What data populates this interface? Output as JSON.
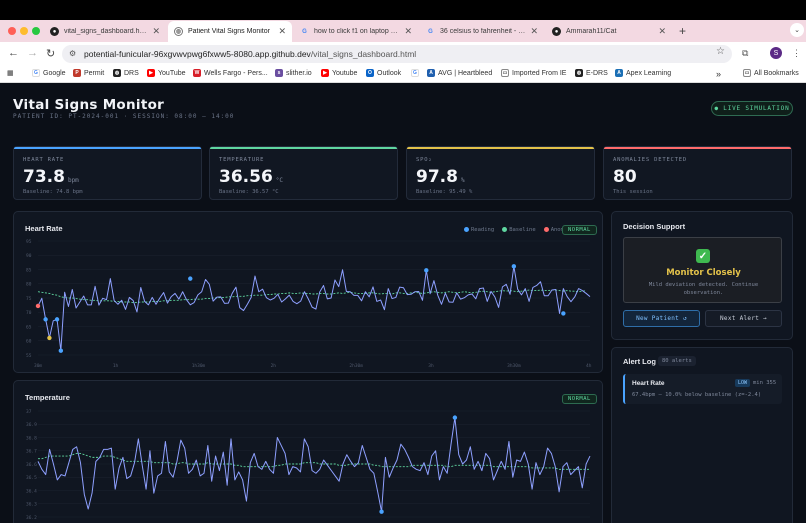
{
  "browser": {
    "tabs": [
      {
        "title": "vital_signs_dashboard.html",
        "favicon": "github-icon",
        "active": false
      },
      {
        "title": "Patient Vital Signs Monitor",
        "favicon": "globe-icon",
        "active": true
      },
      {
        "title": "how to click f1 on laptop - Go",
        "favicon": "google-icon",
        "active": false
      },
      {
        "title": "36 celsius to fahrenheit - Goo",
        "favicon": "google-icon",
        "active": false
      },
      {
        "title": "Ammarah11/Cat",
        "favicon": "github-icon",
        "active": false
      }
    ],
    "url_host": "potential-funicular-96xgvwvpwg6fxww5-8080.app.github.dev",
    "url_path": "/vital_signs_dashboard.html",
    "bookmarks": [
      {
        "label": "Google",
        "icon": "google-icon",
        "color": "#4285f4"
      },
      {
        "label": "Permit",
        "icon": "permit-icon",
        "color": "#c0392b"
      },
      {
        "label": "DRS",
        "icon": "globe-icon",
        "color": "#222222"
      },
      {
        "label": "YouTube",
        "icon": "youtube-icon",
        "color": "#ff0000"
      },
      {
        "label": "Wells Fargo - Pers...",
        "icon": "wellsfargo-icon",
        "color": "#d71e28"
      },
      {
        "label": "slither.io",
        "icon": "slither-icon",
        "color": "#6a4ea0"
      },
      {
        "label": "Youtube",
        "icon": "youtube-icon",
        "color": "#ff0000"
      },
      {
        "label": "Outlook",
        "icon": "outlook-icon",
        "color": "#0a64c8"
      },
      {
        "label": "",
        "icon": "google-icon",
        "color": "#4285f4"
      },
      {
        "label": "AVG | Heartbleed",
        "icon": "avg-icon",
        "color": "#1f5fae"
      },
      {
        "label": "Imported From IE",
        "icon": "folder-icon",
        "color": "#555555"
      },
      {
        "label": "E-DRS",
        "icon": "globe-icon",
        "color": "#222222"
      },
      {
        "label": "Apex Learning",
        "icon": "apex-icon",
        "color": "#1b6fb5"
      }
    ],
    "all_bookmarks": "All Bookmarks"
  },
  "header": {
    "title": "Vital Signs Monitor",
    "subtitle": "PATIENT ID: PT-2024-001  ·  SESSION: 08:00 – 14:00",
    "live_button": "● LIVE SIMULATION"
  },
  "kpis": [
    {
      "label": "Heart Rate",
      "value": "73.8",
      "unit": "bpm",
      "baseline": "Baseline: 74.8 bpm",
      "accent": "#4aa3ff"
    },
    {
      "label": "Temperature",
      "value": "36.56",
      "unit": "°C",
      "baseline": "Baseline: 36.57 °C",
      "accent": "#5fd6a0"
    },
    {
      "label": "SpO₂",
      "value": "97.8",
      "unit": "%",
      "baseline": "Baseline: 95.49 %",
      "accent": "#e3c24a"
    },
    {
      "label": "Anomalies Detected",
      "value": "80",
      "unit": "",
      "baseline": "This session",
      "accent": "#ff6b6b"
    }
  ],
  "heart_chart": {
    "title": "Heart Rate",
    "status": "NORMAL",
    "legend": [
      "Reading",
      "Baseline",
      "Anomaly"
    ],
    "colors": {
      "reading": "#8ea0ff",
      "baseline": "#5fd6a0",
      "anomaly": "#ff6b6b",
      "marker": "#4aa3ff"
    }
  },
  "temp_chart": {
    "title": "Temperature",
    "status": "NORMAL"
  },
  "decision": {
    "title": "Decision Support",
    "status": "Monitor Closely",
    "description": "Mild deviation detected. Continue observation.",
    "new_patient": "New Patient ↺",
    "next_alert": "Next Alert →"
  },
  "alerts": {
    "title": "Alert Log",
    "count": "80 alerts",
    "items": [
      {
        "name": "Heart Rate",
        "severity": "LOW",
        "time": "min 355",
        "desc": "67.4bpm — 10.0% below baseline (z=-2.4)"
      }
    ]
  },
  "chart_data": [
    {
      "type": "line",
      "title": "Heart Rate",
      "ylim": [
        55,
        95
      ],
      "y_ticks": [
        55,
        60,
        65,
        70,
        75,
        80,
        85,
        90,
        95
      ],
      "x_ticks": [
        "30m",
        "1h",
        "1h30m",
        "2h",
        "2h30m",
        "3h",
        "3h30m",
        "4h"
      ],
      "series": [
        {
          "name": "Reading",
          "values": [
            72.2,
            74.9,
            67.5,
            61.0,
            67.0,
            67.5,
            56.5,
            77.0,
            72.0,
            78.0,
            71.5,
            73.6,
            75.7,
            72.6,
            72.6,
            79.1,
            72.5,
            74.9,
            74.4,
            81.8,
            74.1,
            72.8,
            74.2,
            71.0,
            75.2,
            74.1,
            70.1,
            78.7,
            73.8,
            72.6,
            75.2,
            72.8,
            75.0,
            76.9,
            73.2,
            75.5,
            76.6,
            74.6,
            77.2,
            74.4,
            72.6,
            73.4,
            76.1,
            77.2,
            81.5,
            79.8,
            73.9,
            75.3,
            75.4,
            73.1,
            73.2,
            76.6,
            78.8,
            71.6,
            70.6,
            72.8,
            75.2,
            82.7,
            77.2,
            78.1,
            75.1,
            74.3,
            74.9,
            76.3,
            73.6,
            74.7,
            76.0,
            73.8,
            73.0,
            73.9,
            77.2,
            74.7,
            71.8,
            71.1,
            77.1,
            79.4,
            74.7,
            75.0,
            81.3,
            79.0,
            84.9,
            77.3,
            77.2,
            75.9,
            75.9,
            74.0,
            77.2,
            75.4,
            78.9,
            73.8,
            74.3,
            70.9,
            78.3,
            74.8,
            75.2,
            78.8,
            78.6,
            76.2,
            76.3,
            77.2,
            77.3,
            74.2,
            84.7,
            76.5,
            81.1,
            76.0,
            72.8,
            76.7,
            73.6,
            73.5,
            76.8,
            74.6,
            75.1,
            76.1,
            76.4,
            74.7,
            78.3,
            78.5,
            73.8,
            77.3,
            75.4,
            71.7,
            78.9,
            79.8,
            76.3,
            86.1,
            78.1,
            76.1,
            78.3,
            73.8,
            78.7,
            79.4,
            80.7,
            75.8,
            75.8,
            77.8,
            78.0,
            69.6,
            78.3,
            75.5,
            73.7,
            75.4,
            78.3,
            77.6,
            76.6,
            75.5
          ]
        },
        {
          "name": "Baseline",
          "values": [
            77.2,
            77.0,
            76.8,
            76.6,
            76.2,
            76.0,
            75.4,
            75.2,
            75.0,
            75.0,
            74.8,
            74.6,
            74.4,
            74.4,
            74.2,
            74.2,
            74.0,
            74.0,
            74.0,
            74.0,
            73.8,
            73.8,
            73.6,
            73.6,
            73.6,
            73.4,
            73.4,
            73.6,
            73.6,
            73.6,
            73.8,
            73.8,
            73.8,
            74.0,
            74.0,
            74.2,
            74.2,
            74.2,
            74.4,
            74.4,
            74.4,
            74.6,
            74.6,
            74.6,
            74.8,
            74.8,
            75.0,
            75.0,
            75.2,
            75.2,
            75.4,
            75.4,
            75.6,
            75.6,
            75.6,
            75.8,
            75.8,
            76.0,
            76.0,
            76.0,
            76.2,
            76.2,
            76.4,
            76.4,
            76.6,
            76.6,
            76.8,
            76.6,
            76.6,
            76.8,
            76.6,
            76.6,
            76.4,
            76.4,
            76.6,
            76.6,
            76.4,
            76.4,
            76.6,
            76.8,
            76.6,
            76.8,
            77.0,
            76.8,
            76.6,
            76.6,
            76.6,
            76.8,
            76.8,
            76.6,
            76.4,
            76.6,
            76.6,
            76.4,
            76.8,
            76.8,
            76.6,
            76.6,
            76.8,
            77.0,
            76.8,
            76.6,
            76.8,
            77.0,
            77.2,
            77.0,
            76.8,
            77.0,
            77.2,
            77.0,
            76.8,
            77.0,
            77.2,
            77.0,
            76.8,
            77.0,
            77.2,
            77.4,
            77.2,
            77.0,
            77.2,
            77.4,
            77.6,
            77.4,
            77.6,
            77.4,
            77.2,
            77.4,
            77.6,
            77.8,
            77.6,
            77.6,
            77.8,
            77.6,
            77.6,
            77.8,
            77.8,
            77.6,
            77.4,
            77.6,
            77.4,
            77.4,
            77.2,
            77.4,
            77.6
          ]
        }
      ],
      "anomalies": [
        [
          0,
          72.2
        ],
        [
          2,
          67.5
        ],
        [
          3,
          61.0
        ],
        [
          5,
          67.5
        ],
        [
          6,
          56.5
        ],
        [
          40,
          81.8
        ],
        [
          102,
          84.7
        ],
        [
          125,
          86.1
        ],
        [
          138,
          69.6
        ]
      ]
    },
    {
      "type": "line",
      "title": "Temperature",
      "ylim": [
        36.2,
        37.0
      ],
      "y_ticks": [
        36.2,
        36.3,
        36.4,
        36.5,
        36.6,
        36.7,
        36.8,
        36.9,
        37.0
      ],
      "series": [
        {
          "name": "Reading",
          "values": [
            36.62,
            36.56,
            36.52,
            36.71,
            36.6,
            36.48,
            36.52,
            36.51,
            36.61,
            36.71,
            36.73,
            36.61,
            36.37,
            36.26,
            36.38,
            36.62,
            36.65,
            36.71,
            36.71,
            36.72,
            36.41,
            36.57,
            36.65,
            36.49,
            36.51,
            36.61,
            36.79,
            36.59,
            36.41,
            36.7,
            36.38,
            36.51,
            36.53,
            36.77,
            36.54,
            36.5,
            36.62,
            36.78,
            36.72,
            36.53,
            36.56,
            36.63,
            36.51,
            36.53,
            36.74,
            36.47,
            36.66,
            36.55,
            36.69,
            36.44,
            36.79,
            36.48,
            36.54,
            36.48,
            36.32,
            36.61,
            36.68,
            36.58,
            36.56,
            36.62,
            36.56,
            36.53,
            36.8,
            36.74,
            36.68,
            36.52,
            36.58,
            36.57,
            36.54,
            36.79,
            36.73,
            36.55,
            36.53,
            36.56,
            36.63,
            36.59,
            36.55,
            36.51,
            36.47,
            36.6,
            36.67,
            36.62,
            36.58,
            36.61,
            36.74,
            36.65,
            36.56,
            36.53,
            36.39,
            36.24,
            36.65,
            36.5,
            36.57,
            36.63,
            36.75,
            36.71,
            36.65,
            36.58,
            36.56,
            36.55,
            36.61,
            36.52,
            36.66,
            36.7,
            36.48,
            36.58,
            36.53,
            36.75,
            36.95,
            36.67,
            36.6,
            36.63,
            36.73,
            36.56,
            36.62,
            36.55,
            36.68,
            36.64,
            36.48,
            36.55,
            36.62,
            36.56,
            36.77,
            36.5,
            36.63,
            36.62,
            36.69,
            36.6,
            36.41,
            36.61,
            36.52,
            36.58,
            36.72,
            36.68,
            36.58,
            36.39,
            36.58,
            36.61,
            36.52,
            36.55,
            36.58,
            36.42,
            36.6,
            36.66
          ]
        },
        {
          "name": "Baseline",
          "values": [
            36.64,
            36.64,
            36.65,
            36.66,
            36.66,
            36.66,
            36.66,
            36.66,
            36.66,
            36.67,
            36.68,
            36.68,
            36.67,
            36.66,
            36.65,
            36.65,
            36.65,
            36.66,
            36.66,
            36.66,
            36.65,
            36.64,
            36.63,
            36.62,
            36.62,
            36.62,
            36.62,
            36.62,
            36.62,
            36.62,
            36.61,
            36.61,
            36.61,
            36.61,
            36.61,
            36.6,
            36.6,
            36.61,
            36.61,
            36.6,
            36.6,
            36.6,
            36.6,
            36.6,
            36.61,
            36.6,
            36.6,
            36.6,
            36.6,
            36.6,
            36.6,
            36.59,
            36.59,
            36.58,
            36.58,
            36.58,
            36.58,
            36.58,
            36.58,
            36.58,
            36.58,
            36.58,
            36.59,
            36.59,
            36.6,
            36.6,
            36.6,
            36.6,
            36.6,
            36.61,
            36.61,
            36.61,
            36.61,
            36.6,
            36.6,
            36.6,
            36.6,
            36.6,
            36.59,
            36.59,
            36.59,
            36.6,
            36.6,
            36.6,
            36.6,
            36.6,
            36.6,
            36.59,
            36.59,
            36.58,
            36.58,
            36.58,
            36.58,
            36.58,
            36.58,
            36.58,
            36.58,
            36.59,
            36.59,
            36.59,
            36.59,
            36.59,
            36.59,
            36.59,
            36.59,
            36.59,
            36.58,
            36.58,
            36.59,
            36.59,
            36.59,
            36.59,
            36.59,
            36.59,
            36.59,
            36.59,
            36.59,
            36.59,
            36.58,
            36.58,
            36.58,
            36.58,
            36.58,
            36.58,
            36.58,
            36.58,
            36.58,
            36.58,
            36.57,
            36.57,
            36.57,
            36.57,
            36.57,
            36.57,
            36.57,
            36.56,
            36.56,
            36.56,
            36.56,
            36.56,
            36.56,
            36.56,
            36.56,
            36.56
          ]
        }
      ],
      "anomalies": [
        [
          89,
          36.24
        ],
        [
          108,
          36.95
        ]
      ]
    }
  ]
}
